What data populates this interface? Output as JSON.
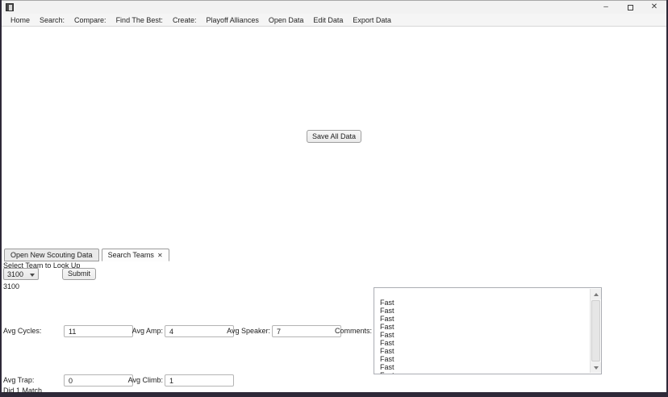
{
  "window": {
    "icons": {
      "minimize": "–",
      "close": "✕"
    }
  },
  "menu": {
    "items": [
      "Home",
      "Search:",
      "Compare:",
      "Find The Best:",
      "Create:",
      "Playoff Alliances",
      "Open Data",
      "Edit Data",
      "Export Data"
    ]
  },
  "main": {
    "save_button": "Save All Data"
  },
  "tabs": [
    {
      "label": "Open New Scouting Data"
    },
    {
      "label": "Search Teams",
      "close": "✕"
    }
  ],
  "search": {
    "select_label": "Select Team to Look Up",
    "team_dropdown_value": "3100",
    "submit_label": "Submit",
    "team_number": "3100",
    "fields": {
      "avg_cycles": {
        "label": "Avg Cycles:",
        "value": "11"
      },
      "avg_amp": {
        "label": "Avg Amp:",
        "value": "4"
      },
      "avg_speaker": {
        "label": "Avg Speaker:",
        "value": "7"
      },
      "avg_trap": {
        "label": "Avg Trap:",
        "value": "0"
      },
      "avg_climb": {
        "label": "Avg Climb:",
        "value": "1"
      }
    },
    "comments": {
      "label": "Comments:",
      "items": [
        "",
        "Fast",
        "Fast",
        "Fast",
        "Fast",
        "Fast",
        "Fast",
        "Fast",
        "Fast",
        "Fast",
        "Fast"
      ]
    },
    "match_result": "Did 1 Match"
  },
  "colors": {
    "frame": "#2e2938",
    "titlebar": "#f2f2f2",
    "menubar": "#f5f5f5",
    "tab_active_bg": "#fdfdfd",
    "tab_inactive_bg": "#eaeaea",
    "field_border": "#b4b4b4"
  }
}
